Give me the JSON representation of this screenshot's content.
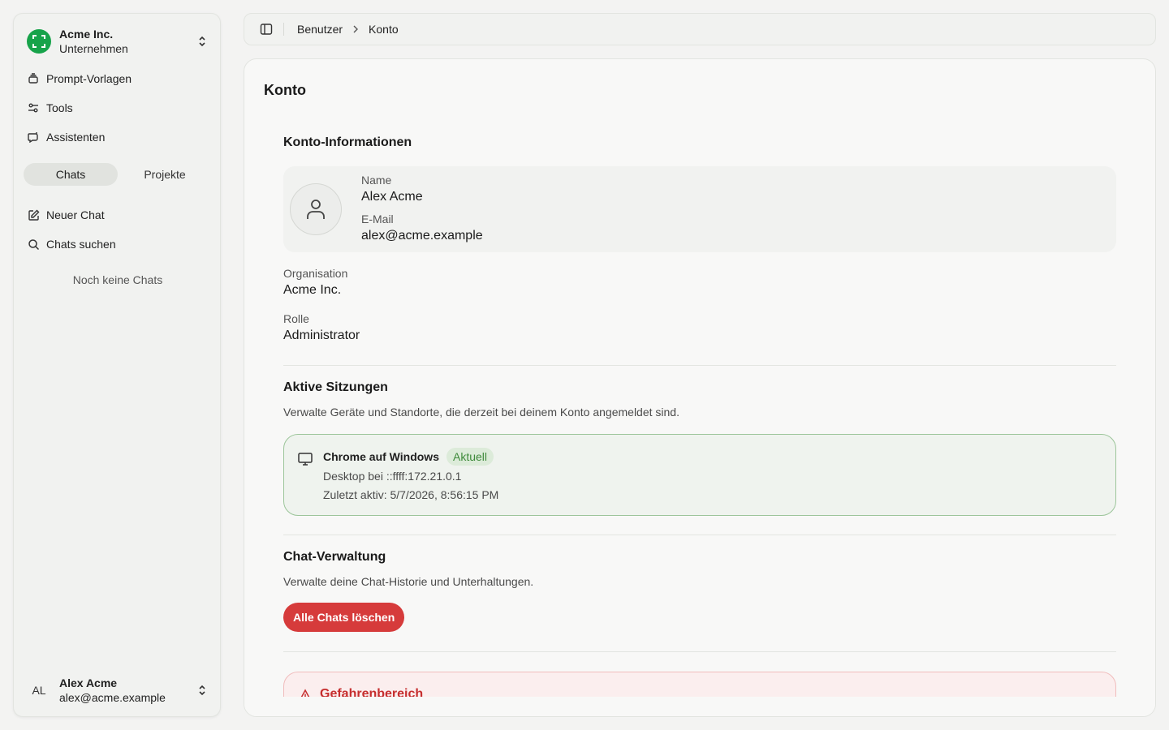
{
  "colors": {
    "brand": "#17a34a",
    "danger": "#d63b3b",
    "current_badge": "#3e8a3a",
    "session_border": "#9cc59a"
  },
  "sidebar": {
    "org": {
      "name": "Acme Inc.",
      "subtitle": "Unternehmen",
      "icon": "scan-icon"
    },
    "nav": [
      {
        "label": "Prompt-Vorlagen",
        "icon": "stack-icon"
      },
      {
        "label": "Tools",
        "icon": "sliders-icon"
      },
      {
        "label": "Assistenten",
        "icon": "bot-icon"
      }
    ],
    "tabs": [
      {
        "label": "Chats",
        "active": true
      },
      {
        "label": "Projekte",
        "active": false
      }
    ],
    "actions": [
      {
        "label": "Neuer Chat",
        "icon": "edit-icon"
      },
      {
        "label": "Chats suchen",
        "icon": "search-icon"
      }
    ],
    "empty_text": "Noch keine Chats",
    "user": {
      "initials": "AL",
      "name": "Alex Acme",
      "email": "alex@acme.example"
    }
  },
  "header": {
    "breadcrumb": [
      "Benutzer",
      "Konto"
    ]
  },
  "main": {
    "title": "Konto",
    "account_info": {
      "title": "Konto-Informationen",
      "name_label": "Name",
      "name": "Alex Acme",
      "email_label": "E-Mail",
      "email": "alex@acme.example",
      "org_label": "Organisation",
      "org": "Acme Inc.",
      "role_label": "Rolle",
      "role": "Administrator"
    },
    "sessions": {
      "title": "Aktive Sitzungen",
      "description": "Verwalte Geräte und Standorte, die derzeit bei deinem Konto angemeldet sind.",
      "items": [
        {
          "device": "Chrome auf Windows",
          "badge": "Aktuell",
          "location": "Desktop bei ::ffff:172.21.0.1",
          "last_active": "Zuletzt aktiv: 5/7/2026, 8:56:15 PM"
        }
      ]
    },
    "chat_management": {
      "title": "Chat-Verwaltung",
      "description": "Verwalte deine Chat-Historie und Unterhaltungen.",
      "delete_button": "Alle Chats löschen"
    },
    "danger_zone": {
      "title": "Gefahrenbereich"
    }
  }
}
